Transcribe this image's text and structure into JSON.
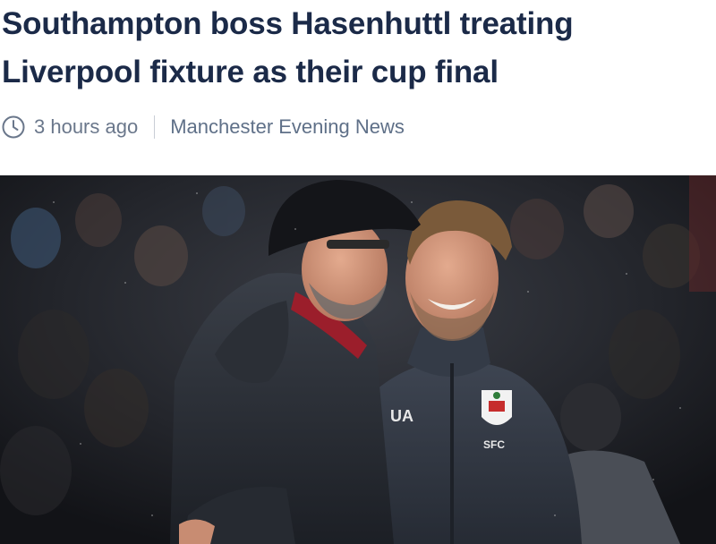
{
  "article": {
    "headline_line1": "Southampton boss Hasenhuttl treating",
    "headline_line2": "Liverpool fixture as their cup final",
    "time_ago": "3 hours ago",
    "source": "Manchester Evening News",
    "time_icon": "clock-icon"
  },
  "photo": {
    "description_icon": "photo",
    "brand_mark": "UA",
    "crest_text": "SFC"
  },
  "colors": {
    "headline": "#1b2a48",
    "meta": "#6a778b",
    "divider": "#c9ced6"
  }
}
